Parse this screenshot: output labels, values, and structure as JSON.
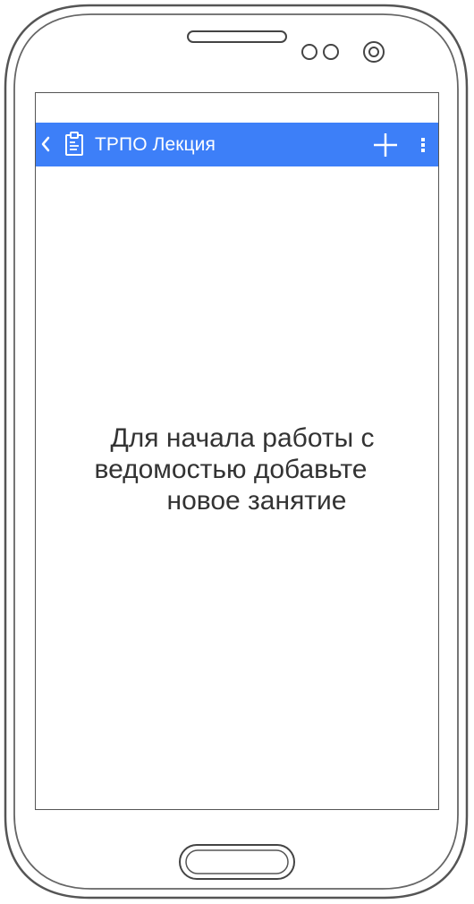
{
  "colors": {
    "appbar": "#3d7ff8",
    "text": "#333333",
    "outline": "#555555"
  },
  "appbar": {
    "back_icon": "chevron-left-icon",
    "app_icon": "clipboard-icon",
    "title": "ТРПО Лекция",
    "add_icon": "plus-icon",
    "menu_icon": "more-vertical-icon"
  },
  "empty_state": {
    "line1": "Для начала работы с",
    "line2": "ведомостью добавьте",
    "line3": "новое занятие"
  }
}
